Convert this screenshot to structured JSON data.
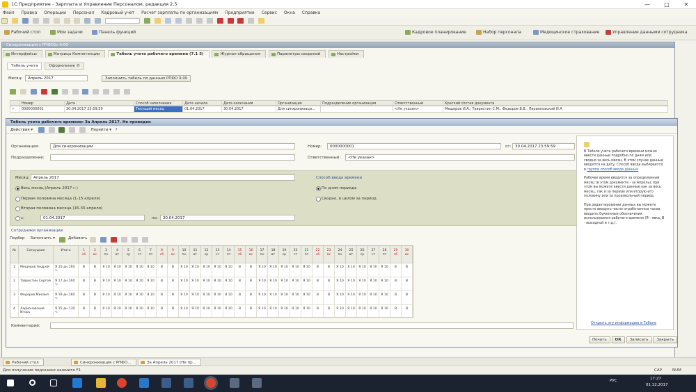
{
  "window": {
    "title": "1С:Предприятие - Зарплата и Управление Персоналом, редакция 2.5",
    "min": "—",
    "max": "□",
    "close": "✕"
  },
  "menu": [
    "Файл",
    "Правка",
    "Операции",
    "Персонал",
    "Кадровый учет",
    "Расчет зарплаты по организациям",
    "Предприятие",
    "Сервис",
    "Окна",
    "Справка"
  ],
  "panel": {
    "left": [
      "Рабочий стол",
      "Мои задачи",
      "Панель функций"
    ],
    "right": [
      "Кадровое планирование",
      "Набор персонала",
      "Медицинское страхование",
      "Управление данными сотрудника"
    ]
  },
  "doc_window_title": "Синхронизация с РПФО1с 9.00",
  "tabs": [
    "Интерфейсы",
    "Матрица Компетенции",
    "Табель учета рабочего времени (7.1 5)",
    "Журнал обращения",
    "Параметры сведений",
    "Настройки"
  ],
  "subtabs": [
    "Табель учета",
    "Оформление ©"
  ],
  "month": {
    "label": "Месяц:",
    "value": "Апрель 2017",
    "fill_button": "Заполнить табель по данным РПФО 9.00"
  },
  "list": {
    "headers": [
      "",
      "Номер",
      "Дата",
      "Способ заполнения",
      "Дата начала",
      "Дата окончания",
      "Организация",
      "Подразделение организации",
      "Ответственный",
      "Краткий состав документа"
    ],
    "row": [
      "✓",
      "0000000001",
      "30.04.2017 23:59:59",
      "Текущий месяц",
      "01.04.2017",
      "30.04.2017",
      "Для синхронизаци...",
      "",
      "<Не указан>",
      "Мещеров И.А., Таврестин С.М., Федоров В.В., Ларионовский И.А"
    ]
  },
  "form": {
    "title": "Табель учета рабочего времени: За Апрель 2017. Не проведен",
    "toolbar": [
      "Действия ▾",
      "Перейти ▾",
      "?"
    ],
    "org_label": "Организация:",
    "org_value": "Для синхронизации",
    "dept_label": "Подразделение:",
    "dept_value": "",
    "number_label": "Номер:",
    "number_value": "0000000001",
    "date_label": "от:",
    "date_value": "30.04.2017 23:59:59",
    "resp_label": "Ответственный:",
    "resp_value": "<Не указан>",
    "month_label": "Месяц:",
    "month_value": "Апрель 2017",
    "period_options": [
      "Весь месяц (Апрель 2017 г.)",
      "Первая половина месяца (1-15 апреля)",
      "Вторая половина месяца (16-30 апреля)",
      "с:"
    ],
    "period_from": "01.04.2017",
    "period_to_label": "по:",
    "period_to": "30.04.2017",
    "input_method_title": "Способ ввода времени",
    "input_methods": [
      "По дням периода",
      "Сводно, в целом за период"
    ],
    "employees_title": "Сотрудники организации",
    "grid_toolbar": [
      "Подбор",
      "Заполнить ▾",
      "Добавить"
    ],
    "comment_label": "Комментарий:",
    "buttons": [
      "Печать",
      "ОК",
      "Записать",
      "Закрыть"
    ]
  },
  "grid": {
    "headers": [
      "№",
      "Сотрудник",
      "Итого"
    ],
    "days": [
      {
        "d": "1",
        "w": "сб",
        "we": true
      },
      {
        "d": "2",
        "w": "вс",
        "we": true
      },
      {
        "d": "3",
        "w": "пн",
        "we": false
      },
      {
        "d": "4",
        "w": "вт",
        "we": false
      },
      {
        "d": "5",
        "w": "ср",
        "we": false
      },
      {
        "d": "6",
        "w": "чт",
        "we": false
      },
      {
        "d": "7",
        "w": "пт",
        "we": false
      },
      {
        "d": "8",
        "w": "сб",
        "we": true
      },
      {
        "d": "9",
        "w": "вс",
        "we": true
      },
      {
        "d": "10",
        "w": "пн",
        "we": false
      },
      {
        "d": "11",
        "w": "вт",
        "we": false
      },
      {
        "d": "12",
        "w": "ср",
        "we": false
      },
      {
        "d": "13",
        "w": "чт",
        "we": false
      },
      {
        "d": "14",
        "w": "пт",
        "we": false
      },
      {
        "d": "15",
        "w": "сб",
        "we": true
      },
      {
        "d": "16",
        "w": "вс",
        "we": true
      },
      {
        "d": "17",
        "w": "пн",
        "we": false
      },
      {
        "d": "18",
        "w": "вт",
        "we": false
      },
      {
        "d": "19",
        "w": "ср",
        "we": false
      },
      {
        "d": "20",
        "w": "чт",
        "we": false
      },
      {
        "d": "21",
        "w": "пт",
        "we": false
      },
      {
        "d": "22",
        "w": "сб",
        "we": true
      },
      {
        "d": "23",
        "w": "вс",
        "we": true
      },
      {
        "d": "24",
        "w": "пн",
        "we": false
      },
      {
        "d": "25",
        "w": "вт",
        "we": false
      },
      {
        "d": "26",
        "w": "ср",
        "we": false
      },
      {
        "d": "27",
        "w": "чт",
        "we": false
      },
      {
        "d": "28",
        "w": "пт",
        "we": false
      },
      {
        "d": "29",
        "w": "сб",
        "we": true
      },
      {
        "d": "30",
        "w": "вс",
        "we": true
      }
    ],
    "rows": [
      {
        "n": "1",
        "name": "Мещеров Андрей",
        "total": "Я 16 дн.160 ч."
      },
      {
        "n": "2",
        "name": "Таврестин Сергей",
        "total": "Я 17 дн.160 ч."
      },
      {
        "n": "3",
        "name": "Федоров Михаил",
        "total": "Я 19 дн.160 ч."
      },
      {
        "n": "4",
        "name": "Ларионовский Игорь",
        "total": "Я 15 дн.130 ч."
      }
    ],
    "workday_mark": "Я 10",
    "weekend_mark": "В"
  },
  "help": {
    "text1": "В Табеле учета рабочего времени можно ввести данные подробно по дням или сводно за весь месяц. В этом случае данные вводятся на дату. Способ ввода выбирается в",
    "link1": "группе способ ввода данных",
    "text2": "Рабочее время вводится за определенный месяц (в этом документе - за Апрель), при этом вы можете ввести данные как за весь месяц, так и за первую или вторую его половину или за произвольный период.",
    "text3": "При редактировании данных вы можете просто вводить число отработанных часов, вводить буквенные обозначения использования рабочего времени (Я - явка, В - выходной и т.д.).",
    "link2": "Открыть эту информацию в Табеле"
  },
  "window_tabs": [
    "Рабочий стол",
    "Синхронизация с РПФО...",
    "За Апрель 2017 (Не пр..."
  ],
  "status": "Для получения подсказки нажмите F1",
  "status_right": [
    "CAP",
    "NUM"
  ],
  "tray": {
    "time": "17:27",
    "date": "01.12.2017",
    "lang": "РУС"
  }
}
